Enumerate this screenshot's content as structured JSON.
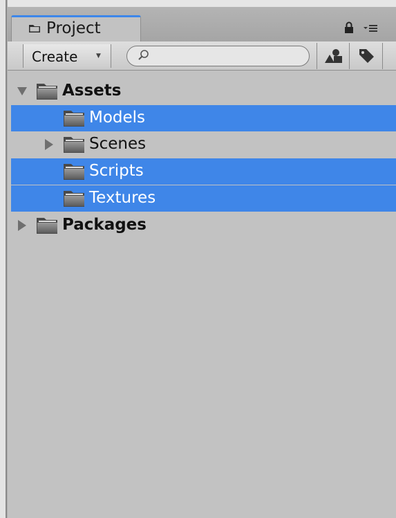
{
  "window": {
    "tab_title": "Project"
  },
  "toolbar": {
    "create_label": "Create",
    "search": {
      "value": "",
      "placeholder": ""
    }
  },
  "tree": [
    {
      "label": "Assets",
      "level": 0,
      "expanded": true,
      "has_children": true,
      "selected": false,
      "bold": true
    },
    {
      "label": "Models",
      "level": 1,
      "has_children": false,
      "selected": true,
      "bold": false
    },
    {
      "label": "Scenes",
      "level": 1,
      "expanded": false,
      "has_children": true,
      "selected": false,
      "bold": false
    },
    {
      "label": "Scripts",
      "level": 1,
      "has_children": false,
      "selected": true,
      "bold": false
    },
    {
      "label": "Textures",
      "level": 1,
      "has_children": false,
      "selected": true,
      "bold": false
    },
    {
      "label": "Packages",
      "level": 0,
      "expanded": false,
      "has_children": true,
      "selected": false,
      "bold": true
    }
  ],
  "colors": {
    "selection": "#3f86e8",
    "panel_background": "#c2c2c2",
    "tab_accent": "#3d87ea"
  }
}
